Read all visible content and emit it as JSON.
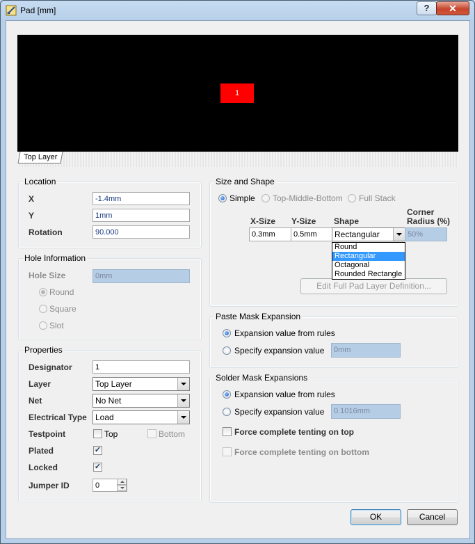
{
  "window": {
    "title": "Pad [mm]",
    "help_label": "?",
    "close_label": "✕"
  },
  "preview": {
    "pad_label": "1",
    "layer_tab": "Top Layer",
    "pad_color": "#ff0000"
  },
  "location": {
    "title": "Location",
    "x_label": "X",
    "x_value": "-1.4mm",
    "y_label": "Y",
    "y_value": "1mm",
    "rotation_label": "Rotation",
    "rotation_value": "90.000"
  },
  "hole": {
    "title": "Hole Information",
    "size_label": "Hole Size",
    "size_value": "0mm",
    "options": [
      "Round",
      "Square",
      "Slot"
    ]
  },
  "properties": {
    "title": "Properties",
    "designator_label": "Designator",
    "designator_value": "1",
    "layer_label": "Layer",
    "layer_value": "Top Layer",
    "net_label": "Net",
    "net_value": "No Net",
    "elec_label": "Electrical Type",
    "elec_value": "Load",
    "testpoint_label": "Testpoint",
    "testpoint_top": "Top",
    "testpoint_bottom": "Bottom",
    "plated_label": "Plated",
    "locked_label": "Locked",
    "jumper_label": "Jumper ID",
    "jumper_value": "0"
  },
  "size_shape": {
    "title": "Size and Shape",
    "modes": [
      "Simple",
      "Top-Middle-Bottom",
      "Full Stack"
    ],
    "col_xsize": "X-Size",
    "col_ysize": "Y-Size",
    "col_shape": "Shape",
    "col_corner_1": "Corner",
    "col_corner_2": "Radius (%)",
    "xsize": "0.3mm",
    "ysize": "0.5mm",
    "shape": "Rectangular",
    "corner": "50%",
    "shape_options": [
      "Round",
      "Rectangular",
      "Octagonal",
      "Rounded Rectangle"
    ],
    "edit_button": "Edit Full Pad Layer Definition..."
  },
  "paste_mask": {
    "title": "Paste Mask Expansion",
    "from_rules": "Expansion value from rules",
    "specify": "Specify expansion value",
    "value": "0mm"
  },
  "solder_mask": {
    "title": "Solder Mask Expansions",
    "from_rules": "Expansion value from rules",
    "specify": "Specify expansion value",
    "value": "0.1016mm",
    "tent_top": "Force complete tenting on top",
    "tent_bottom": "Force complete tenting on bottom"
  },
  "buttons": {
    "ok": "OK",
    "cancel": "Cancel"
  }
}
